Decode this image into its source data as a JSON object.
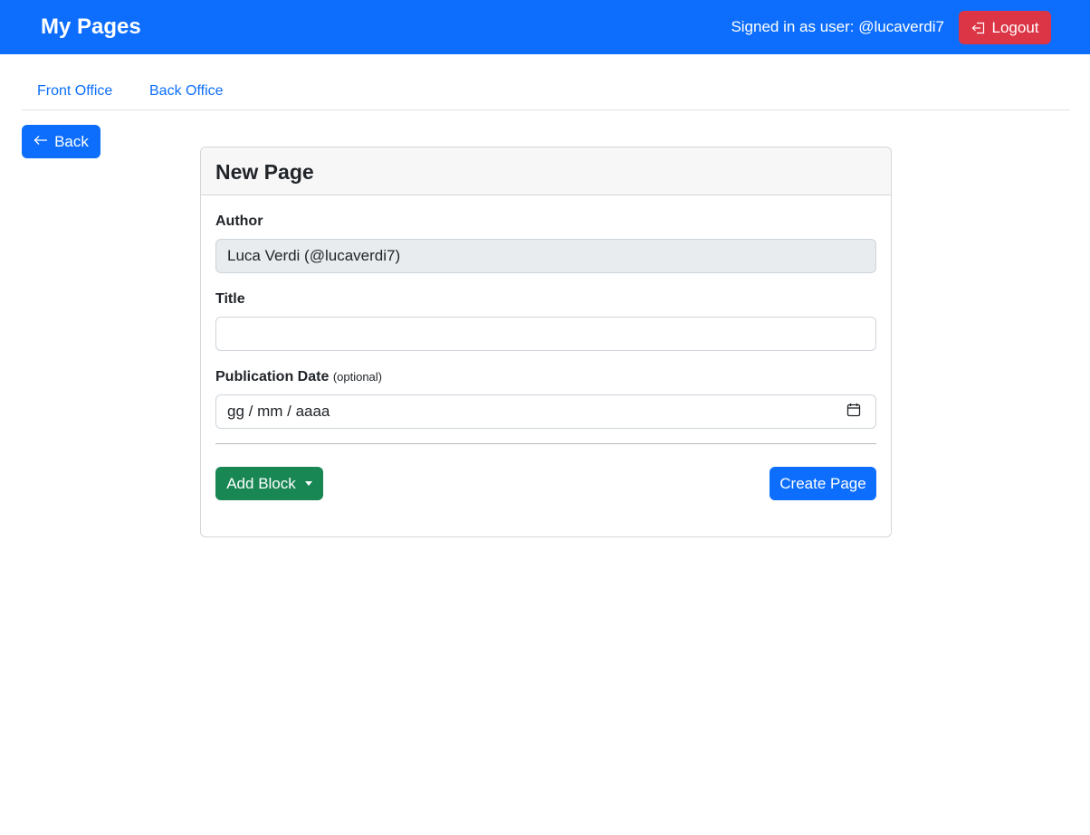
{
  "navbar": {
    "brand": "My Pages",
    "signed_in_text": "Signed in as user: @lucaverdi7",
    "logout_label": "Logout",
    "color": "#0d6efd"
  },
  "tabs": [
    {
      "label": "Front Office"
    },
    {
      "label": "Back Office"
    }
  ],
  "back_button": {
    "label": "Back",
    "icon": "arrow-left-icon"
  },
  "form": {
    "title": "New Page",
    "author": {
      "label": "Author",
      "value": "Luca Verdi (@lucaverdi7)"
    },
    "title_field": {
      "label": "Title",
      "value": ""
    },
    "publication_date": {
      "label": "Publication Date",
      "hint": "(optional)",
      "placeholder": "gg / mm / aaaa",
      "icon": "calendar-icon"
    },
    "add_block_label": "Add Block",
    "create_label": "Create Page"
  },
  "colors": {
    "primary": "#0d6efd",
    "danger": "#dc3545",
    "success": "#198754"
  }
}
